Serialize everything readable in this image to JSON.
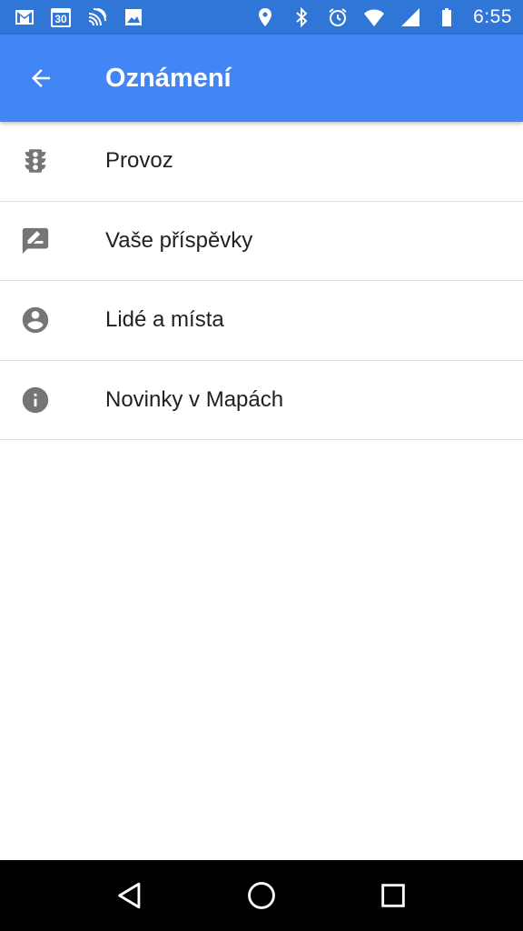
{
  "status_bar": {
    "time": "6:55",
    "left_icons": [
      "gmail-icon",
      "calendar-icon",
      "cast-icon",
      "image-icon"
    ],
    "calendar_day": "30",
    "right_icons": [
      "location-icon",
      "bluetooth-icon",
      "alarm-icon",
      "wifi-icon",
      "signal-icon",
      "battery-icon"
    ]
  },
  "app_bar": {
    "title": "Oznámení",
    "background": "#4285f4"
  },
  "list": {
    "items": [
      {
        "label": "Provoz",
        "icon": "traffic-light-icon"
      },
      {
        "label": "Vaše příspěvky",
        "icon": "rate-review-icon"
      },
      {
        "label": "Lidé a místa",
        "icon": "account-circle-icon"
      },
      {
        "label": "Novinky v Mapách",
        "icon": "info-icon"
      }
    ]
  },
  "nav_bar": {
    "buttons": [
      "back-icon",
      "home-icon",
      "recents-icon"
    ]
  },
  "colors": {
    "status_bar": "#3076d6",
    "app_bar": "#4285f4",
    "icon_gray": "#757575",
    "divider": "#e0e0e0",
    "text": "#212121"
  }
}
